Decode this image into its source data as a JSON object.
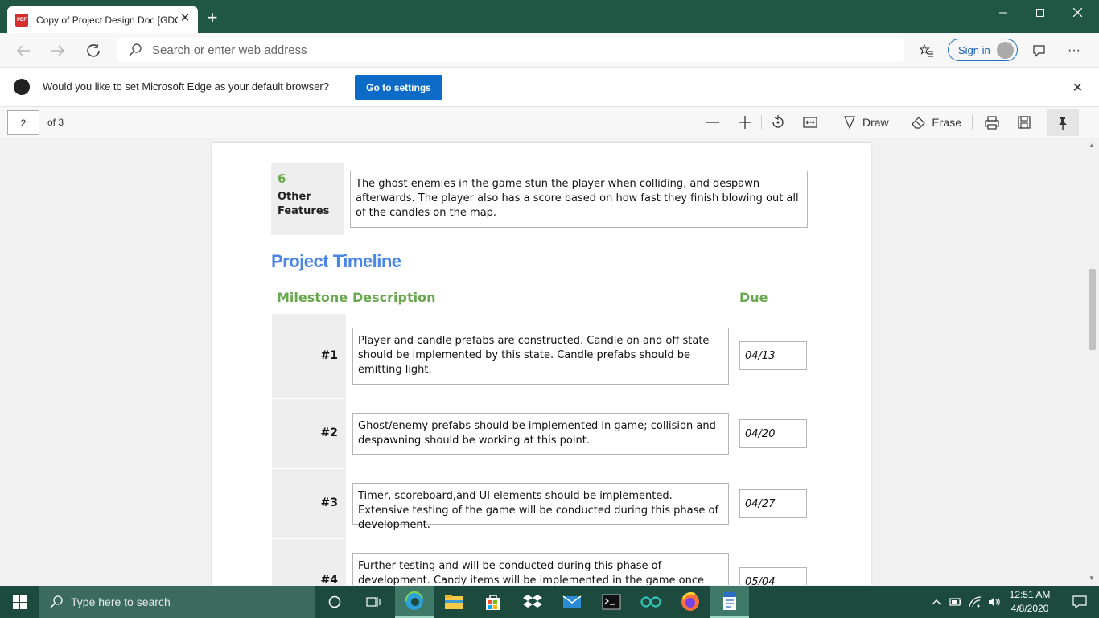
{
  "browser": {
    "tab_title": "Copy of Project Design Doc [GDC",
    "pdf_badge": "PDF",
    "address_placeholder": "Search or enter web address",
    "signin_label": "Sign in"
  },
  "infobar": {
    "message": "Would you like to set Microsoft Edge as your default browser?",
    "button_label": "Go to settings"
  },
  "pdf_toolbar": {
    "current_page": "2",
    "page_total": "of 3",
    "draw_label": "Draw",
    "erase_label": "Erase"
  },
  "document": {
    "feature": {
      "number": "6",
      "title_line1": "Other",
      "title_line2": "Features",
      "text": "The ghost enemies in the game stun the player when colliding, and despawn afterwards. The player also has a score based on how fast they finish blowing out all of the candles on the map."
    },
    "section_title": "Project Timeline",
    "columns": {
      "milestone": "Milestone",
      "description": "Description",
      "due": "Due"
    },
    "milestones": [
      {
        "id": "#1",
        "description": "Player and candle prefabs are constructed. Candle on and off state should be implemented by this state. Candle prefabs should be emitting light.",
        "due": "04/13"
      },
      {
        "id": "#2",
        "description": "Ghost/enemy  prefabs should be implemented in game; collision and despawning should be working at this point.",
        "due": "04/20"
      },
      {
        "id": "#3",
        "description": "Timer, scoreboard,and UI elements should be implemented. Extensive testing of the game will be conducted during this phase of development.",
        "due": "04/27"
      },
      {
        "id": "#4",
        "description": "Further testing and will be conducted during this phase of development. Candy items will be implemented in the game once the timer feature has",
        "due": "05/04"
      }
    ]
  },
  "taskbar": {
    "search_placeholder": "Type here to search",
    "time": "12:51 AM",
    "date": "4/8/2020"
  },
  "colors": {
    "titlebar": "#1f5744",
    "taskbar": "#1c4a3d",
    "accent_blue": "#0b6bc7",
    "heading_blue": "#4a86e8",
    "table_header_green": "#6aa84f",
    "feature_number_green": "#6aa84f"
  }
}
